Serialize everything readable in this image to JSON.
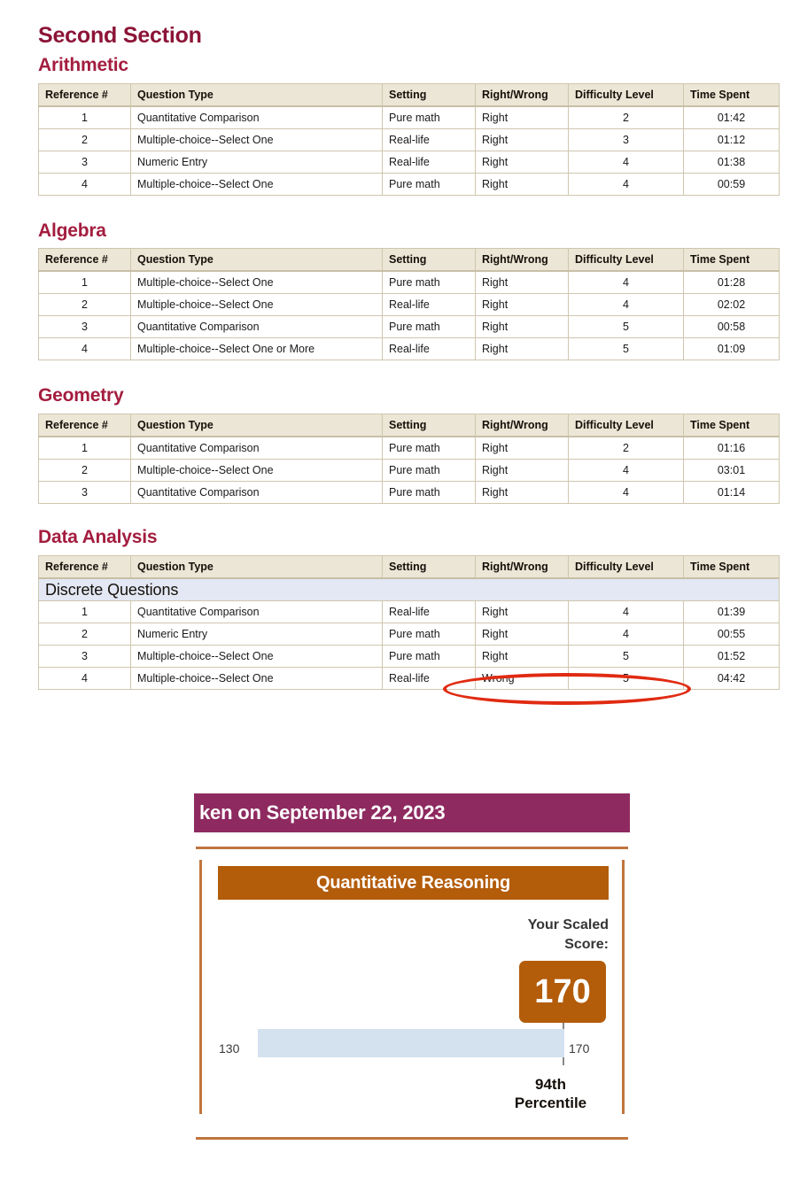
{
  "section": {
    "title": "Second Section"
  },
  "columns": [
    "Reference #",
    "Question Type",
    "Setting",
    "Right/Wrong",
    "Difficulty Level",
    "Time Spent"
  ],
  "groups": [
    {
      "title": "Arithmetic",
      "rows": [
        {
          "ref": "1",
          "type": "Quantitative Comparison",
          "setting": "Pure math",
          "rw": "Right",
          "difficulty": "2",
          "time": "01:42"
        },
        {
          "ref": "2",
          "type": "Multiple-choice--Select One",
          "setting": "Real-life",
          "rw": "Right",
          "difficulty": "3",
          "time": "01:12"
        },
        {
          "ref": "3",
          "type": "Numeric Entry",
          "setting": "Real-life",
          "rw": "Right",
          "difficulty": "4",
          "time": "01:38"
        },
        {
          "ref": "4",
          "type": "Multiple-choice--Select One",
          "setting": "Pure math",
          "rw": "Right",
          "difficulty": "4",
          "time": "00:59"
        }
      ]
    },
    {
      "title": "Algebra",
      "rows": [
        {
          "ref": "1",
          "type": "Multiple-choice--Select One",
          "setting": "Pure math",
          "rw": "Right",
          "difficulty": "4",
          "time": "01:28"
        },
        {
          "ref": "2",
          "type": "Multiple-choice--Select One",
          "setting": "Real-life",
          "rw": "Right",
          "difficulty": "4",
          "time": "02:02"
        },
        {
          "ref": "3",
          "type": "Quantitative Comparison",
          "setting": "Pure math",
          "rw": "Right",
          "difficulty": "5",
          "time": "00:58"
        },
        {
          "ref": "4",
          "type": "Multiple-choice--Select One or More",
          "setting": "Real-life",
          "rw": "Right",
          "difficulty": "5",
          "time": "01:09"
        }
      ]
    },
    {
      "title": "Geometry",
      "rows": [
        {
          "ref": "1",
          "type": "Quantitative Comparison",
          "setting": "Pure math",
          "rw": "Right",
          "difficulty": "2",
          "time": "01:16"
        },
        {
          "ref": "2",
          "type": "Multiple-choice--Select One",
          "setting": "Pure math",
          "rw": "Right",
          "difficulty": "4",
          "time": "03:01"
        },
        {
          "ref": "3",
          "type": "Quantitative Comparison",
          "setting": "Pure math",
          "rw": "Right",
          "difficulty": "4",
          "time": "01:14"
        }
      ]
    },
    {
      "title": "Data Analysis",
      "subgroup_label": "Discrete Questions",
      "rows": [
        {
          "ref": "1",
          "type": "Quantitative Comparison",
          "setting": "Real-life",
          "rw": "Right",
          "difficulty": "4",
          "time": "01:39"
        },
        {
          "ref": "2",
          "type": "Numeric Entry",
          "setting": "Pure math",
          "rw": "Right",
          "difficulty": "4",
          "time": "00:55"
        },
        {
          "ref": "3",
          "type": "Multiple-choice--Select One",
          "setting": "Pure math",
          "rw": "Right",
          "difficulty": "5",
          "time": "01:52"
        },
        {
          "ref": "4",
          "type": "Multiple-choice--Select One",
          "setting": "Real-life",
          "rw": "Wrong",
          "difficulty": "5",
          "time": "04:42"
        }
      ]
    }
  ],
  "annotation": {
    "shape": "ellipse",
    "color": "#e02b12",
    "highlights": "Wrong"
  },
  "score_report": {
    "banner_text": "ken on September 22, 2023",
    "measure": "Quantitative Reasoning",
    "scaled_score_label": "Your Scaled\nScore:",
    "scaled_score_label_line1": "Your Scaled",
    "scaled_score_label_line2": "Score:",
    "scaled_score": "170",
    "bar_min_label": "130",
    "bar_max_label": "170",
    "percentile_line1": "94th",
    "percentile_line2": "Percentile",
    "colors": {
      "banner": "#8e2a60",
      "measure_header": "#b35c0a",
      "score_box": "#b35c0a",
      "bar_fill": "#d4e2f0",
      "frame": "#c0753e"
    }
  },
  "chart_data": {
    "type": "bar",
    "title": "Quantitative Reasoning",
    "orientation": "horizontal",
    "xlabel": "",
    "ylabel": "",
    "categories": [
      "Quantitative Reasoning"
    ],
    "values": [
      170
    ],
    "xlim": [
      130,
      170
    ],
    "tick_labels": [
      "130",
      "170"
    ],
    "grid": false,
    "legend": "none",
    "annotations": [
      "Your Scaled Score: 170",
      "94th Percentile"
    ]
  }
}
